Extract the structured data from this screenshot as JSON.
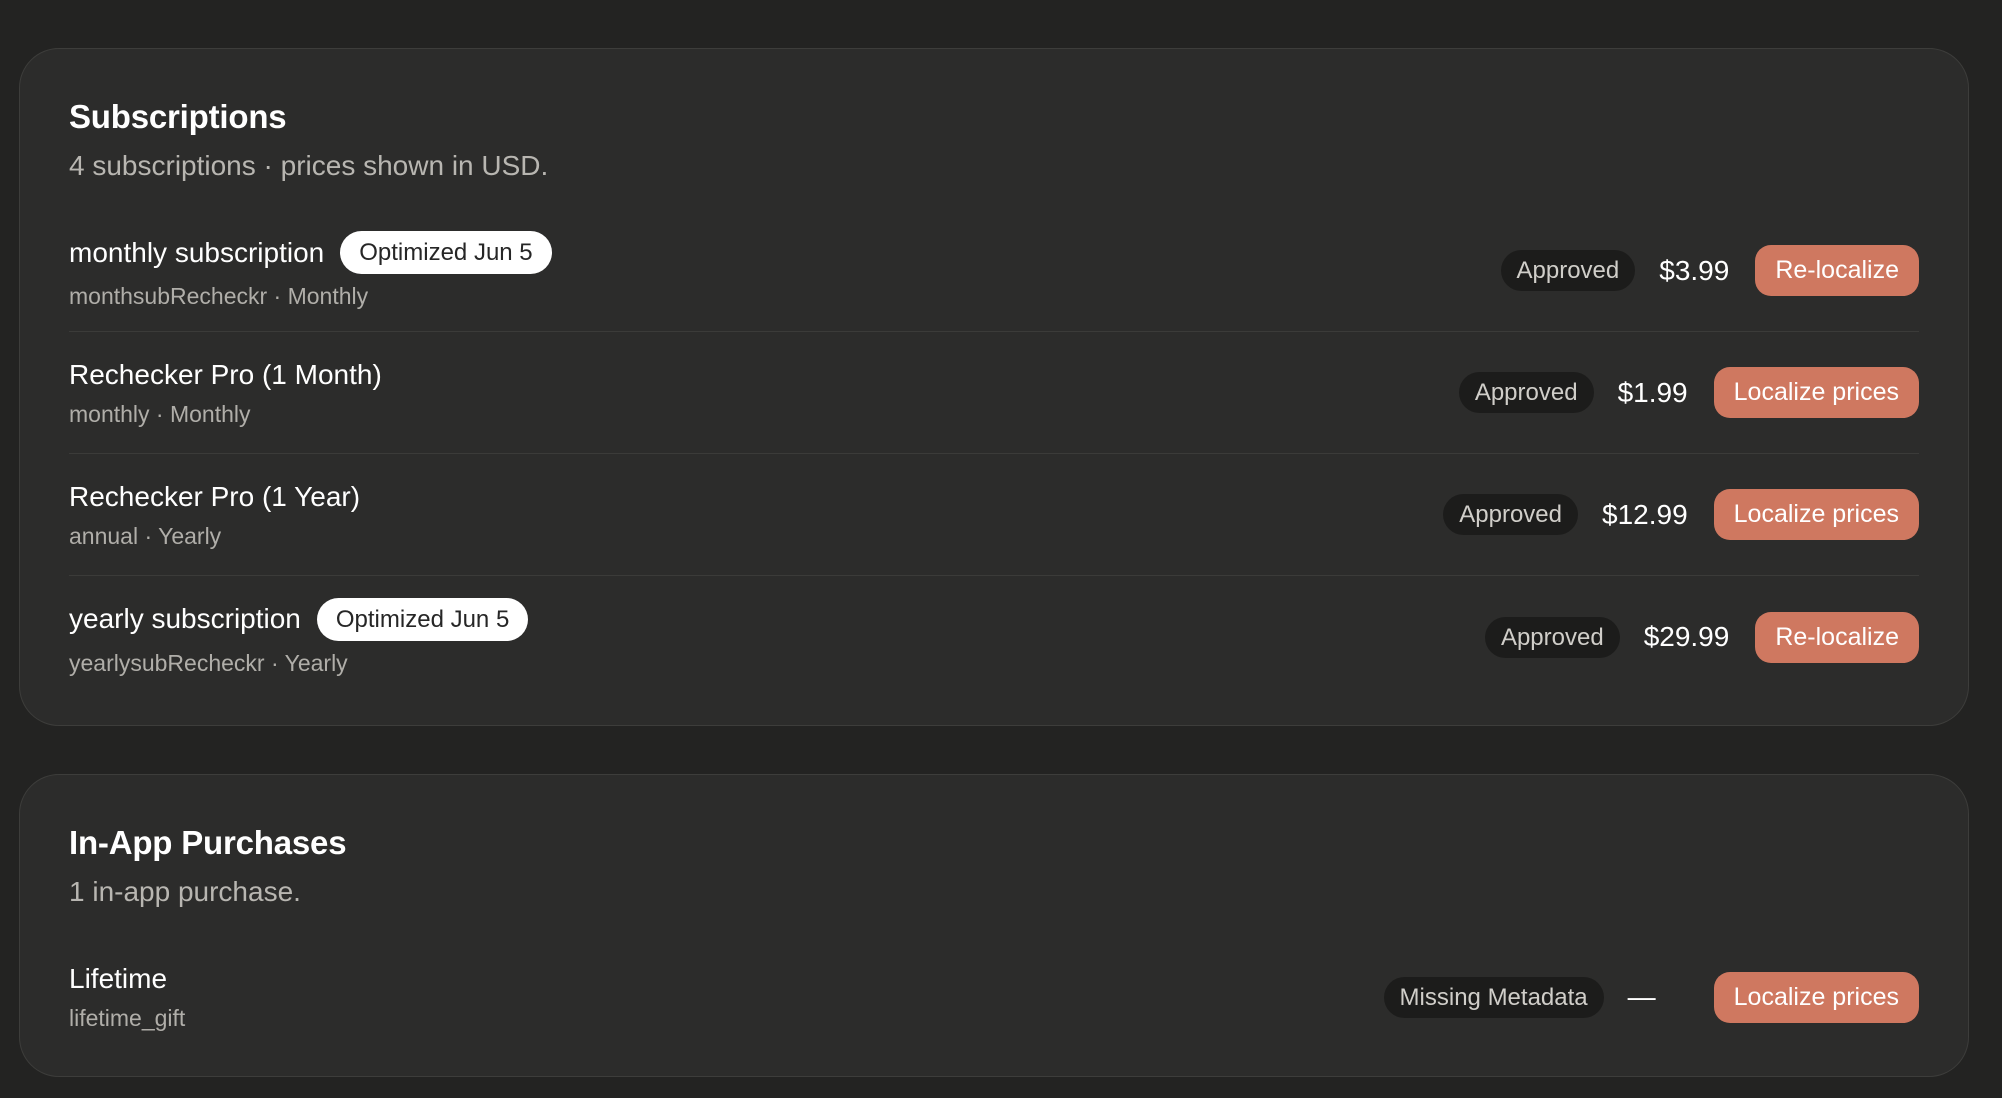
{
  "subscriptions": {
    "title": "Subscriptions",
    "subtitle": "4 subscriptions · prices shown in USD.",
    "items": [
      {
        "name": "monthly subscription",
        "badge": "Optimized Jun 5",
        "meta": "monthsubRecheckr · Monthly",
        "status": "Approved",
        "price": "$3.99",
        "action": "Re-localize"
      },
      {
        "name": "Rechecker Pro (1 Month)",
        "badge": "",
        "meta": "monthly · Monthly",
        "status": "Approved",
        "price": "$1.99",
        "action": "Localize prices"
      },
      {
        "name": "Rechecker Pro (1 Year)",
        "badge": "",
        "meta": "annual · Yearly",
        "status": "Approved",
        "price": "$12.99",
        "action": "Localize prices"
      },
      {
        "name": "yearly subscription",
        "badge": "Optimized Jun 5",
        "meta": "yearlysubRecheckr · Yearly",
        "status": "Approved",
        "price": "$29.99",
        "action": "Re-localize"
      }
    ]
  },
  "in_app_purchases": {
    "title": "In-App Purchases",
    "subtitle": "1 in-app purchase.",
    "items": [
      {
        "name": "Lifetime",
        "meta": "lifetime_gift",
        "status": "Missing Metadata",
        "price": "—",
        "action": "Localize prices"
      }
    ]
  },
  "colors": {
    "background": "#232322",
    "card": "#2c2c2b",
    "accent_button": "#cf7860",
    "badge_dark": "#1c1c1b",
    "badge_light": "#ffffff"
  }
}
